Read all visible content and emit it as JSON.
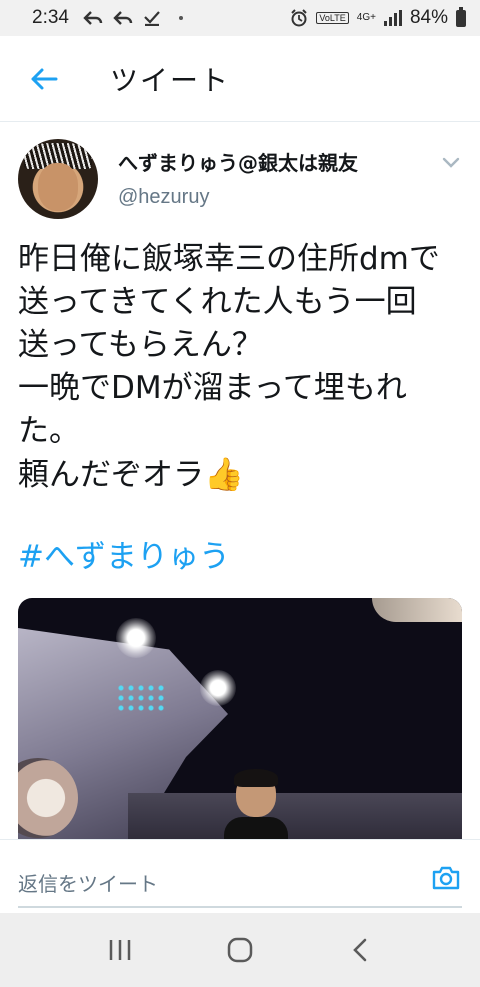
{
  "status_bar": {
    "time": "2:34",
    "notification_icons": [
      "reply-icon",
      "reply-icon",
      "download-done-icon",
      "dot-icon"
    ],
    "volte": "VoLTE",
    "network": "4G+",
    "battery_percent": "84%"
  },
  "header": {
    "title": "ツイート"
  },
  "tweet": {
    "display_name": "へずまりゅう@銀太は親友",
    "handle": "@hezuruy",
    "text": "昨日俺に飯塚幸三の住所dmで\n送ってきてくれた人もう一回\n送ってもらえん？\n一晩でDMが溜まって埋もれ\nた。\n頼んだぞオラ",
    "emoji": "👍",
    "hashtag": "#へずまりゅう"
  },
  "reply": {
    "placeholder": "返信をツイート"
  },
  "colors": {
    "accent": "#1da1f2",
    "text": "#14171a",
    "muted": "#657786"
  }
}
